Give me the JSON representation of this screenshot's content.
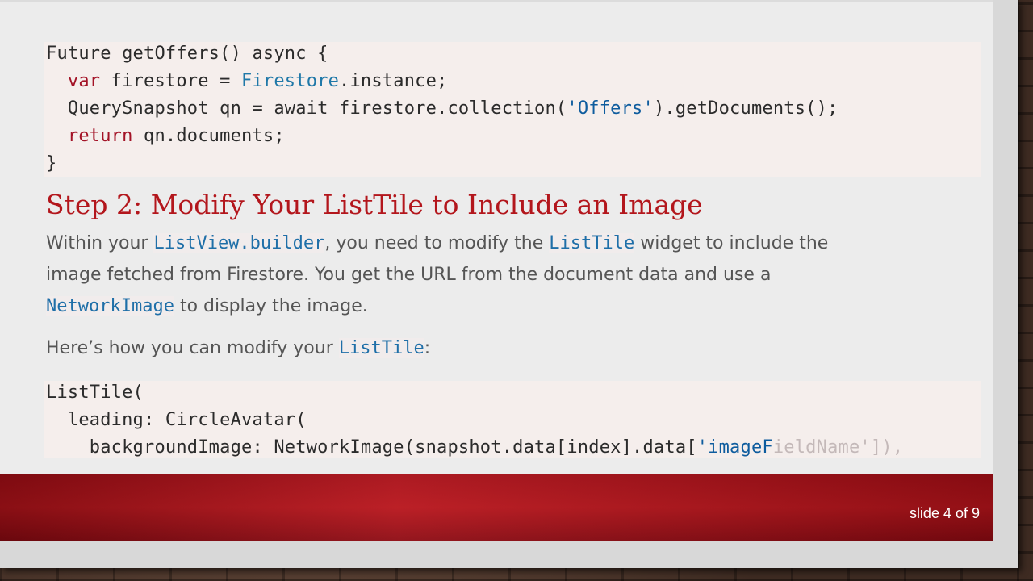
{
  "code_top": {
    "l1": "Future getOffers() async {",
    "l2_kw": "var",
    "l2_a": " firestore = ",
    "l2_cls": "Firestore",
    "l2_b": ".instance;",
    "l3_a": "QuerySnapshot qn = await firestore.collection(",
    "l3_str": "'Offers'",
    "l3_b": ").getDocuments();",
    "l4_kw": "return",
    "l4_a": " qn.documents;",
    "l5": "}"
  },
  "heading": "Step 2: Modify Your ListTile to Include an Image",
  "para1": {
    "t1": "Within your ",
    "c1": "ListView.builder",
    "t2": ", you need to modify the ",
    "c2": "ListTile",
    "t3": " widget to include the",
    "line2": "image fetched from Firestore. You get the URL from the document data and use a",
    "c3": "NetworkImage",
    "t4": " to display the image."
  },
  "para2": {
    "t1": "Here’s how you can modify your ",
    "c1": "ListTile",
    "t2": ":"
  },
  "code_bottom": {
    "l1": "ListTile(",
    "l2": "  leading: CircleAvatar(",
    "l3_a": "    backgroundImage: NetworkImage(snapshot.data[index].data[",
    "l3_str": "'imageF",
    "l3_fade": "ieldName'",
    "l3_end": "]),"
  },
  "footer": {
    "slide_label": "slide 4 of 9"
  },
  "colors": {
    "heading": "#b3161c",
    "footer": "#b8141b",
    "keyword": "#a31226",
    "class": "#1f78a8"
  }
}
